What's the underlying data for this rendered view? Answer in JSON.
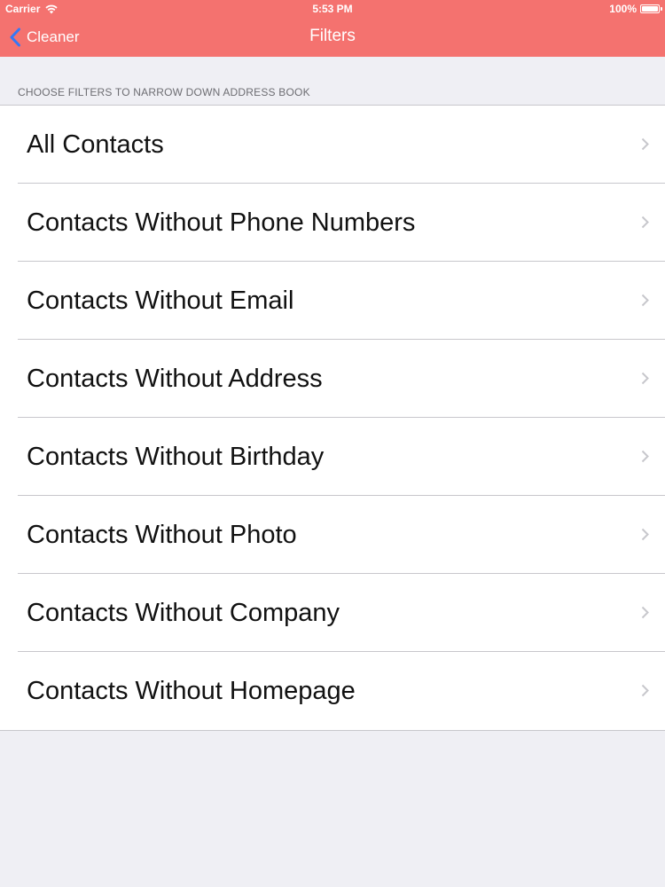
{
  "status_bar": {
    "carrier": "Carrier",
    "time": "5:53 PM",
    "battery": "100%",
    "battery_level": 1.0
  },
  "nav": {
    "back_label": "Cleaner",
    "title": "Filters",
    "back_icon": "chevron-left-icon"
  },
  "section": {
    "header": "CHOOSE FILTERS TO NARROW DOWN ADDRESS BOOK"
  },
  "filters": [
    {
      "label": "All Contacts"
    },
    {
      "label": "Contacts Without Phone Numbers"
    },
    {
      "label": "Contacts Without Email"
    },
    {
      "label": "Contacts Without Address"
    },
    {
      "label": "Contacts Without Birthday"
    },
    {
      "label": "Contacts Without Photo"
    },
    {
      "label": "Contacts Without Company"
    },
    {
      "label": "Contacts Without Homepage"
    }
  ],
  "colors": {
    "nav_background": "#f4726f",
    "back_icon": "#3478f6",
    "page_background": "#efeff4",
    "chevron": "#c7c7cc"
  }
}
